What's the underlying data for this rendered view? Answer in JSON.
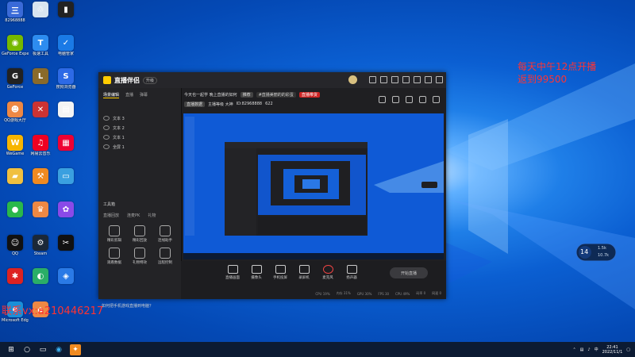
{
  "desktop_icons": [
    {
      "label": "82968888",
      "icon": "cube-icon",
      "color": "#3a6ad8",
      "glyph": "三",
      "col": 0,
      "row": 0
    },
    {
      "label": "",
      "icon": "recycle-bin-icon",
      "color": "#d8e4f0",
      "glyph": "♲",
      "col": 1,
      "row": 0
    },
    {
      "label": "",
      "icon": "game-icon",
      "color": "#222",
      "glyph": "▮",
      "col": 2,
      "row": 0
    },
    {
      "label": "GeForce Experience",
      "icon": "nvidia-icon",
      "color": "#76b900",
      "glyph": "◉",
      "col": 0,
      "row": 1
    },
    {
      "label": "极速工具",
      "icon": "app-icon",
      "color": "#2d8cf0",
      "glyph": "T",
      "col": 1,
      "row": 1
    },
    {
      "label": "电脑管家",
      "icon": "shield-icon",
      "color": "#1a7ae6",
      "glyph": "✓",
      "col": 2,
      "row": 1
    },
    {
      "label": "GeForce",
      "icon": "g-icon",
      "color": "#222",
      "glyph": "G",
      "col": 0,
      "row": 2
    },
    {
      "label": "",
      "icon": "league-icon",
      "color": "#8a6a2a",
      "glyph": "L",
      "col": 1,
      "row": 2
    },
    {
      "label": "搜狗浏览器",
      "icon": "s-icon",
      "color": "#2d6ae6",
      "glyph": "S",
      "col": 2,
      "row": 2
    },
    {
      "label": "QQ游戏大厅",
      "icon": "penguin-game-icon",
      "color": "#e84",
      "glyph": "☻",
      "col": 0,
      "row": 3
    },
    {
      "label": "",
      "icon": "cross-icon",
      "color": "#c33",
      "glyph": "✕",
      "col": 1,
      "row": 3
    },
    {
      "label": "",
      "icon": "doc-icon",
      "color": "#f4f4f4",
      "glyph": "▤",
      "col": 2,
      "row": 3
    },
    {
      "label": "WeGame",
      "icon": "wegame-icon",
      "color": "#f7b500",
      "glyph": "W",
      "col": 0,
      "row": 4
    },
    {
      "label": "网易云音乐",
      "icon": "music-icon",
      "color": "#e02",
      "glyph": "♫",
      "col": 1,
      "row": 4
    },
    {
      "label": "",
      "icon": "store-icon",
      "color": "#e03",
      "glyph": "▦",
      "col": 2,
      "row": 4
    },
    {
      "label": "",
      "icon": "folder-icon",
      "color": "#f0c040",
      "glyph": "▰",
      "col": 0,
      "row": 5
    },
    {
      "label": "",
      "icon": "tools-icon",
      "color": "#f08a20",
      "glyph": "⚒",
      "col": 1,
      "row": 5
    },
    {
      "label": "",
      "icon": "screen-icon",
      "color": "#3aa0e0",
      "glyph": "▭",
      "col": 2,
      "row": 5
    },
    {
      "label": "",
      "icon": "bean-icon",
      "color": "#2ab84a",
      "glyph": "●",
      "col": 0,
      "row": 6
    },
    {
      "label": "",
      "icon": "crown-icon",
      "color": "#e84",
      "glyph": "♛",
      "col": 1,
      "row": 6
    },
    {
      "label": "",
      "icon": "palette-icon",
      "color": "#8a4ae8",
      "glyph": "✿",
      "col": 2,
      "row": 6
    },
    {
      "label": "QQ",
      "icon": "qq-icon",
      "color": "#111",
      "glyph": "☺",
      "col": 0,
      "row": 7
    },
    {
      "label": "Steam",
      "icon": "steam-icon",
      "color": "#1b2838",
      "glyph": "⚙",
      "col": 1,
      "row": 7
    },
    {
      "label": "",
      "icon": "capcut-icon",
      "color": "#111",
      "glyph": "✂",
      "col": 2,
      "row": 7
    },
    {
      "label": "",
      "icon": "red-app-icon",
      "color": "#d22",
      "glyph": "✱",
      "col": 0,
      "row": 8
    },
    {
      "label": "",
      "icon": "wechat-icon",
      "color": "#2aae67",
      "glyph": "◐",
      "col": 1,
      "row": 8
    },
    {
      "label": "",
      "icon": "gallery-icon",
      "color": "#2a7ae6",
      "glyph": "◈",
      "col": 2,
      "row": 8
    },
    {
      "label": "Microsoft Edge",
      "icon": "edge-icon",
      "color": "#1a8fd8",
      "glyph": "e",
      "col": 0,
      "row": 9
    },
    {
      "label": "",
      "icon": "shop-icon",
      "color": "#e84",
      "glyph": "⌂",
      "col": 1,
      "row": 9
    }
  ],
  "overlay": {
    "line1": "每天中午12点开播",
    "line2": "返到99500",
    "contact": "联系vx:a210446217",
    "red": "#ff3333"
  },
  "app": {
    "name": "直播伴侣",
    "version": "升级",
    "left_tabs": [
      "场景编辑",
      "直播",
      "弹幕"
    ],
    "sources": [
      "文本 3",
      "文本 2",
      "文本 1",
      "全屏 1"
    ],
    "tools_title": "工具箱",
    "tools_sub": [
      "直播回放",
      "连麦PK",
      "礼物"
    ],
    "tools": [
      "精彩剪辑",
      "精彩回放",
      "连线助手",
      "观看数据",
      "礼物特效",
      "远程控制"
    ],
    "more": "更多功能",
    "notice": "如何把手机游戏直播到电脑？",
    "title_line": "今天也一起学 晚上直播的如何",
    "tag1": "推荐",
    "tag2": "#直播美丽的的彩蛋",
    "tag_red": "直播带货",
    "row2_badge": "直播数据",
    "row2_text": "主播等级 大神",
    "row2_id": "ID:82968888",
    "row2_count": "622",
    "controls": [
      "直播画面",
      "摄像头",
      "手机投屏",
      "录屏机",
      "麦克风",
      "扬声器"
    ],
    "start_live": "开始直播",
    "status": [
      "CPU 19%",
      "内存 31%",
      "GPU 30%",
      "FPS 30",
      "CPU 49%",
      "码率 0",
      "网速 0"
    ]
  },
  "widget": {
    "temp": "14",
    "unit": "°",
    "line1": "1.5k",
    "line2": "10.7k"
  },
  "taskbar": {
    "time": "22:41",
    "date": "2022/11/1"
  }
}
